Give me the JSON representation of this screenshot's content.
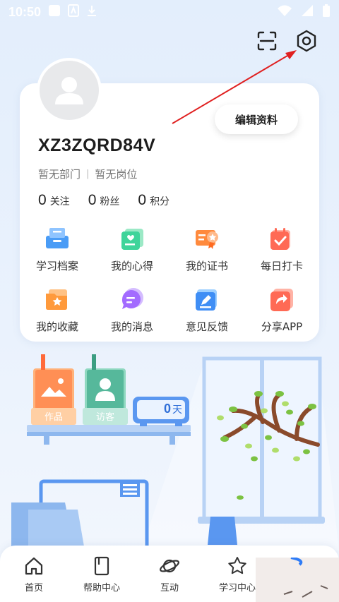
{
  "status_bar": {
    "time": "10:50"
  },
  "profile": {
    "username": "XZ3ZQRD84V",
    "department": "暂无部门",
    "position": "暂无岗位",
    "edit_label": "编辑资料"
  },
  "stats": [
    {
      "num": "0",
      "label": "关注"
    },
    {
      "num": "0",
      "label": "粉丝"
    },
    {
      "num": "0",
      "label": "积分"
    }
  ],
  "menu": [
    {
      "label": "学习档案",
      "icon": "study-file-icon",
      "color": "#4a9cf6"
    },
    {
      "label": "我的心得",
      "icon": "notes-icon",
      "color": "#3fd49a"
    },
    {
      "label": "我的证书",
      "icon": "certificate-icon",
      "color": "#ff8a3d"
    },
    {
      "label": "每日打卡",
      "icon": "checkin-icon",
      "color": "#ff6a55"
    },
    {
      "label": "我的收藏",
      "icon": "favorites-icon",
      "color": "#ff9a3c"
    },
    {
      "label": "我的消息",
      "icon": "message-icon",
      "color": "#a36bff"
    },
    {
      "label": "意见反馈",
      "icon": "feedback-icon",
      "color": "#3f8ef5"
    },
    {
      "label": "分享APP",
      "icon": "share-icon",
      "color": "#ff6a55"
    }
  ],
  "scene": {
    "works_label": "作品",
    "visitors_label": "访客",
    "days_count": "0",
    "days_unit": "天"
  },
  "bottom_nav": [
    {
      "label": "首页",
      "icon": "home-icon"
    },
    {
      "label": "帮助中心",
      "icon": "help-book-icon"
    },
    {
      "label": "互动",
      "icon": "planet-icon"
    },
    {
      "label": "学习中心",
      "icon": "star-icon"
    }
  ],
  "colors": {
    "accent": "#2f7cf6",
    "annotation_arrow": "#e02020"
  }
}
